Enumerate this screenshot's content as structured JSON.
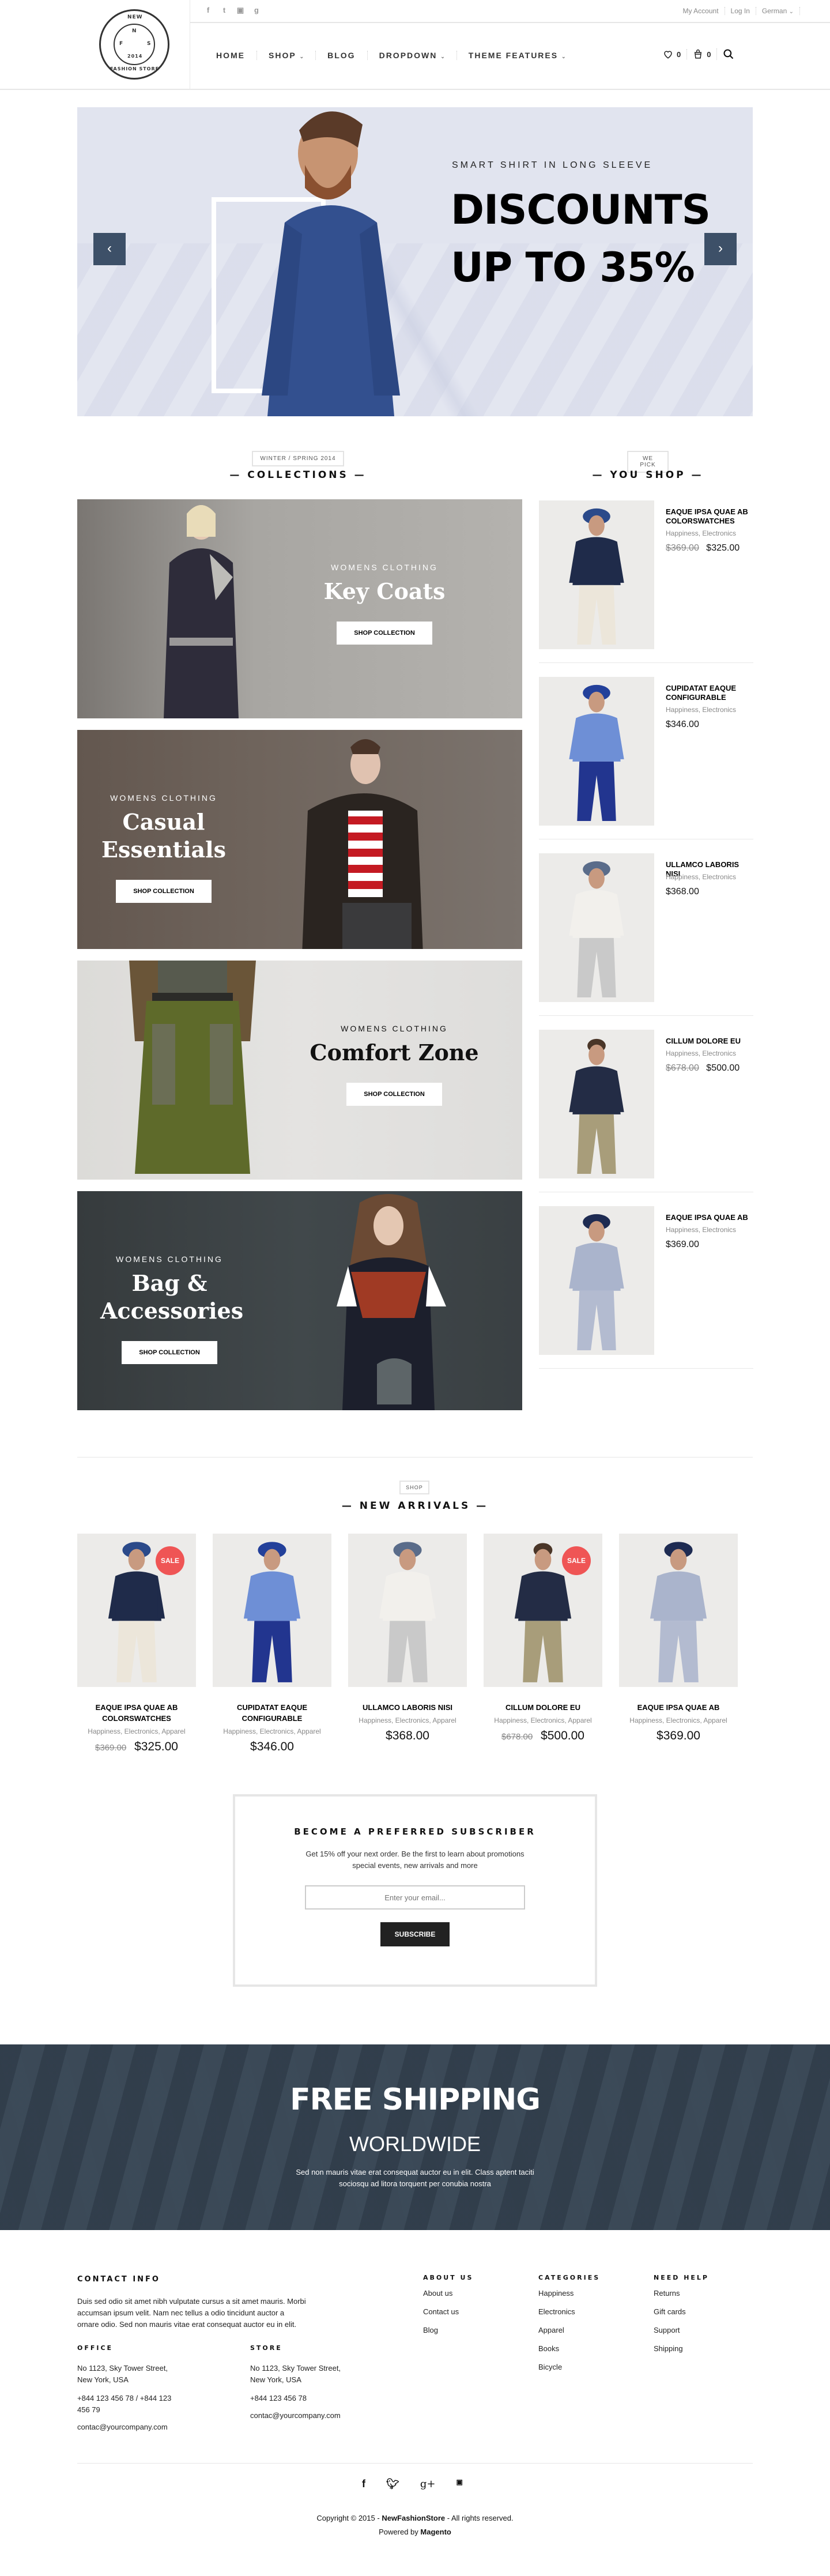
{
  "header": {
    "logo": {
      "top": "NEW",
      "bottom": "FASHION STORE",
      "year": "2014",
      "compass": [
        "N",
        "F",
        "S"
      ]
    },
    "social": [
      "facebook-icon",
      "twitter-icon",
      "youtube-icon",
      "google-plus-icon"
    ],
    "top_links": [
      "My Account",
      "Log In",
      "German"
    ],
    "nav": [
      {
        "label": "HOME",
        "dropdown": false
      },
      {
        "label": "SHOP",
        "dropdown": true
      },
      {
        "label": "BLOG",
        "dropdown": false
      },
      {
        "label": "DROPDOWN",
        "dropdown": true
      },
      {
        "label": "THEME FEATURES",
        "dropdown": true
      }
    ],
    "wishlist_count": "0",
    "cart_count": "0"
  },
  "hero": {
    "subtitle": "SMART SHIRT IN LONG SLEEVE",
    "title_line1": "DISCOUNTS",
    "title_line2": "UP TO 35%",
    "prev": "‹",
    "next": "›"
  },
  "collections": {
    "tag": "WINTER / SPRING 2014",
    "title": "— COLLECTIONS —",
    "items": [
      {
        "kicker": "WOMENS CLOTHING",
        "title": "Key Coats",
        "button": "SHOP COLLECTION"
      },
      {
        "kicker": "WOMENS CLOTHING",
        "title": "Casual Essentials",
        "button": "SHOP COLLECTION"
      },
      {
        "kicker": "WOMENS CLOTHING",
        "title": "Comfort Zone",
        "button": "SHOP COLLECTION"
      },
      {
        "kicker": "WOMENS CLOTHING",
        "title": "Bag & Accessories",
        "button": "SHOP COLLECTION"
      }
    ]
  },
  "you_shop": {
    "tag": "WE PICK",
    "title": "— YOU SHOP —",
    "items": [
      {
        "name": "EAQUE IPSA QUAE AB COLORSWATCHES",
        "categories": "Happiness, Electronics",
        "old_price": "$369.00",
        "price": "$325.00"
      },
      {
        "name": "CUPIDATAT EAQUE CONFIGURABLE",
        "categories": "Happiness, Electronics",
        "old_price": null,
        "price": "$346.00"
      },
      {
        "name": "ULLAMCO LABORIS NISI",
        "categories": "Happiness, Electronics",
        "old_price": null,
        "price": "$368.00"
      },
      {
        "name": "CILLUM DOLORE EU",
        "categories": "Happiness, Electronics",
        "old_price": "$678.00",
        "price": "$500.00"
      },
      {
        "name": "EAQUE IPSA QUAE AB",
        "categories": "Happiness, Electronics",
        "old_price": null,
        "price": "$369.00"
      }
    ]
  },
  "new_arrivals": {
    "tag": "SHOP",
    "title": "— NEW ARRIVALS —",
    "sale_label": "SALE",
    "items": [
      {
        "name": "EAQUE IPSA QUAE AB COLORSWATCHES",
        "categories": "Happiness, Electronics, Apparel",
        "old_price": "$369.00",
        "price": "$325.00",
        "sale": true
      },
      {
        "name": "CUPIDATAT EAQUE CONFIGURABLE",
        "categories": "Happiness, Electronics, Apparel",
        "old_price": null,
        "price": "$346.00",
        "sale": false
      },
      {
        "name": "ULLAMCO LABORIS NISI",
        "categories": "Happiness, Electronics, Apparel",
        "old_price": null,
        "price": "$368.00",
        "sale": false
      },
      {
        "name": "CILLUM DOLORE EU",
        "categories": "Happiness, Electronics, Apparel",
        "old_price": "$678.00",
        "price": "$500.00",
        "sale": true
      },
      {
        "name": "EAQUE IPSA QUAE AB",
        "categories": "Happiness, Electronics, Apparel",
        "old_price": null,
        "price": "$369.00",
        "sale": false
      }
    ]
  },
  "subscribe": {
    "title": "BECOME A PREFERRED SUBSCRIBER",
    "text": "Get 15% off your next order. Be the first to learn about promotions special events, new arrivals and more",
    "placeholder": "Enter your email...",
    "button": "SUBSCRIBE"
  },
  "shipping": {
    "title": "FREE SHIPPING",
    "subtitle": "WORLDWIDE",
    "text": "Sed non mauris vitae erat consequat auctor eu in elit. Class aptent taciti sociosqu ad litora torquent per conubia nostra"
  },
  "footer": {
    "contact": {
      "title": "CONTACT INFO",
      "text": "Duis sed odio sit amet nibh vulputate cursus a sit amet mauris. Morbi accumsan ipsum velit. Nam nec tellus a odio tincidunt auctor a ornare odio. Sed non mauris vitae erat consequat auctor eu in elit.",
      "office": {
        "title": "OFFICE",
        "address": "No 1123, Sky Tower Street, New York, USA",
        "phone": "+844 123 456 78 / +844 123 456 79",
        "email": "contac@yourcompany.com"
      },
      "store": {
        "title": "STORE",
        "address": "No 1123, Sky Tower Street, New York, USA",
        "phone": "+844 123 456 78",
        "email": "contac@yourcompany.com"
      }
    },
    "columns": [
      {
        "title": "ABOUT US",
        "links": [
          "About us",
          "Contact us",
          "Blog"
        ]
      },
      {
        "title": "CATEGORIES",
        "links": [
          "Happiness",
          "Electronics",
          "Apparel",
          "Books",
          "Bicycle"
        ]
      },
      {
        "title": "NEED HELP",
        "links": [
          "Returns",
          "Gift cards",
          "Support",
          "Shipping"
        ]
      }
    ],
    "social": [
      "facebook-icon",
      "twitter-icon",
      "google-plus-icon",
      "youtube-icon"
    ],
    "copyright_prefix": "Copyright © 2015 - ",
    "brand": "NewFashionStore",
    "copyright_suffix": " - All rights reserved.",
    "powered_prefix": "Powered by ",
    "powered_brand": "Magento"
  },
  "colors": {
    "accent_dark": "#3d5068",
    "sale": "#ef5555",
    "shipping_bg": "#3b4957",
    "hero_bg": "#e1e4ef"
  }
}
